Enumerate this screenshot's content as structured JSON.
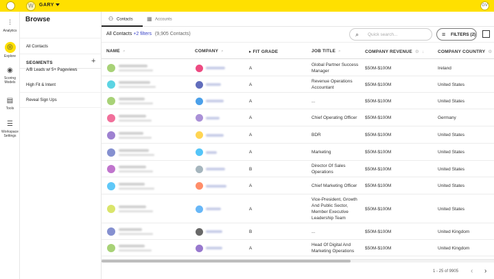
{
  "topbar": {
    "workspace_initial": "W",
    "workspace_name": "GARY",
    "user_initials": "GV"
  },
  "rail": [
    {
      "label": "Analytics",
      "icon": "bar-chart-icon"
    },
    {
      "label": "Explore",
      "icon": "compass-icon"
    },
    {
      "label": "Scoring Models",
      "icon": "target-icon"
    },
    {
      "label": "Tools",
      "icon": "toolbox-icon"
    },
    {
      "label": "Workspace Settings",
      "icon": "sliders-icon"
    }
  ],
  "sidebar": {
    "title": "Browse",
    "all_contacts": "All Contacts",
    "segments_title": "SEGMENTS",
    "add_symbol": "+",
    "segments": [
      "A/B Leads w/ 5+ Pageviews",
      "High Fit & Intent",
      "Reveal Sign Ups"
    ]
  },
  "tabs": [
    {
      "label": "Contacts",
      "icon": "person-icon",
      "active": true
    },
    {
      "label": "Accounts",
      "icon": "building-icon",
      "active": false
    }
  ],
  "toolbar": {
    "crumb_title": "All Contacts",
    "filters_link": "+2 filters",
    "count": "(9,905 Contacts)",
    "search_placeholder": "Quick search...",
    "filters_button": "FILTERS (2)"
  },
  "columns": [
    "NAME",
    "COMPANY",
    "FIT GRADE",
    "JOB TITLE",
    "COMPANY REVENUE",
    "COMPANY COUNTRY"
  ],
  "rows": [
    {
      "fit": "A",
      "title": "Global Partner Success Manager",
      "revenue": "$50M-$100M",
      "country": "Ireland",
      "avatar": "#8bc34a",
      "logo": "#e91e63"
    },
    {
      "fit": "A",
      "title": "Revenue Operations Accountant",
      "revenue": "$50M-$100M",
      "country": "United States",
      "avatar": "#26c6da",
      "logo": "#3949ab"
    },
    {
      "fit": "A",
      "title": "...",
      "revenue": "$50M-$100M",
      "country": "United States",
      "avatar": "#8bc34a",
      "logo": "#1e88e5"
    },
    {
      "fit": "A",
      "title": "Chief Operating Officer",
      "revenue": "$50M-$100M",
      "country": "Germany",
      "avatar": "#ec407a",
      "logo": "#9575cd"
    },
    {
      "fit": "A",
      "title": "BDR",
      "revenue": "$50M-$100M",
      "country": "United States",
      "avatar": "#7e57c2",
      "logo": "#ffca28"
    },
    {
      "fit": "A",
      "title": "Marketing",
      "revenue": "$50M-$100M",
      "country": "United States",
      "avatar": "#5c6bc0",
      "logo": "#29b6f6"
    },
    {
      "fit": "B",
      "title": "Director Of Sales Operations",
      "revenue": "$50M-$100M",
      "country": "United States",
      "avatar": "#ab47bc",
      "logo": "#90a4ae"
    },
    {
      "fit": "A",
      "title": "Chief Marketing Officer",
      "revenue": "$50M-$100M",
      "country": "United States",
      "avatar": "#29b6f6",
      "logo": "#ff7043"
    },
    {
      "fit": "A",
      "title": "Vice-President, Growth And Public Sector, Member Executive Leadership Team",
      "revenue": "$50M-$100M",
      "country": "United States",
      "avatar": "#cddc39",
      "logo": "#42a5f5"
    },
    {
      "fit": "B",
      "title": "...",
      "revenue": "$50M-$100M",
      "country": "United Kingdom",
      "avatar": "#5c6bc0",
      "logo": "#424242"
    },
    {
      "fit": "A",
      "title": "Head Of Digital And Marketing Operations",
      "revenue": "$50M-$100M",
      "country": "United Kingdom",
      "avatar": "#8bc34a",
      "logo": "#7e57c2"
    }
  ],
  "pagination": {
    "text": "1 - 25 of 9905",
    "prev": "‹",
    "next": "›"
  }
}
